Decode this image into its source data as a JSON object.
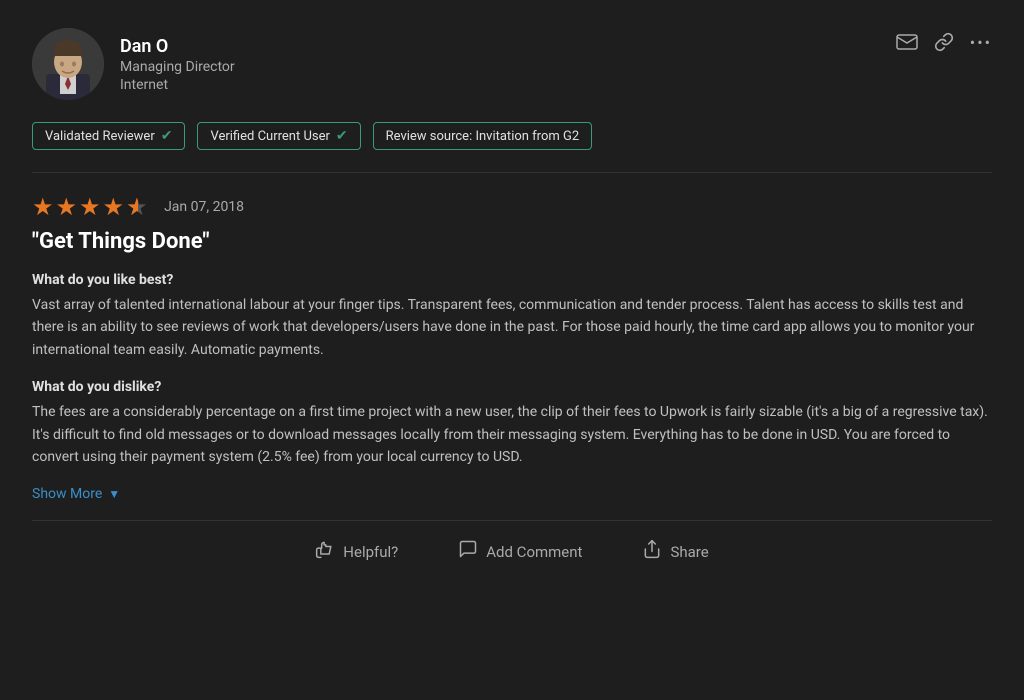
{
  "user": {
    "name": "Dan O",
    "role": "Managing Director",
    "industry": "Internet"
  },
  "badges": [
    {
      "label": "Validated Reviewer",
      "has_check": true
    },
    {
      "label": "Verified Current User",
      "has_check": true
    },
    {
      "label": "Review source: Invitation from G2",
      "has_check": false
    }
  ],
  "review": {
    "stars": 4.5,
    "date": "Jan 07, 2018",
    "title": "\"Get Things Done\"",
    "like_label": "What do you like best?",
    "like_text": "Vast array of talented international labour at your finger tips. Transparent fees, communication and tender process. Talent has access to skills test and there is an ability to see reviews of work that developers/users have done in the past. For those paid hourly, the time card app allows you to monitor your international team easily. Automatic payments.",
    "dislike_label": "What do you dislike?",
    "dislike_text": "The fees are a considerably percentage on a first time project with a new user, the clip of their fees to Upwork is fairly sizable (it's a big of a regressive tax). It's difficult to find old messages or to download messages locally from their messaging system. Everything has to be done in USD. You are forced to convert using their payment system (2.5% fee) from your local currency to USD.",
    "show_more": "Show More"
  },
  "footer": {
    "helpful_label": "Helpful?",
    "comment_label": "Add Comment",
    "share_label": "Share"
  },
  "icons": {
    "mail": "✉",
    "link": "🔗",
    "more": "•••",
    "check": "✔",
    "chevron_down": "▼",
    "helpful": "👍",
    "comment": "💬",
    "share": "↗"
  }
}
